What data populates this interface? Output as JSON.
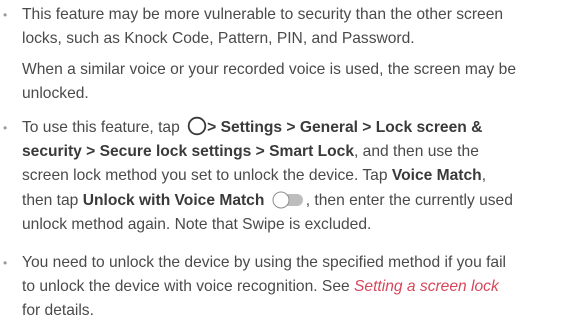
{
  "bullet_symbol": "•",
  "item1": {
    "line1": "This feature may be more vulnerable to security than the other screen",
    "line2": "locks, such as Knock Code, Pattern, PIN, and Password.",
    "line3": "When a similar voice or your recorded voice is used, the screen may be",
    "line4": "unlocked."
  },
  "item2": {
    "p1": "To use this feature, tap",
    "sep": ">",
    "settings": "Settings",
    "general": "General",
    "lock_screen": "Lock screen &",
    "security": "security",
    "secure_lock_settings": "Secure lock settings",
    "smart_lock": "Smart Lock",
    "p2": ", and then use the",
    "p3": "screen lock method you set to unlock the device. Tap",
    "voice_match": "Voice Match",
    "comma": ",",
    "p4": "then tap",
    "unlock_with_voice_match": "Unlock with Voice Match",
    "p5": ", then enter the currently used",
    "p6": "unlock method again. Note that Swipe is excluded."
  },
  "item3": {
    "line1": "You need to unlock the device by using the specified method if you fail",
    "line2_a": "to unlock the device with voice recognition. See",
    "link": "Setting a screen lock",
    "line3": "for details."
  },
  "icons": {
    "home": "home-button-icon",
    "toggle": "toggle-switch-icon"
  },
  "colors": {
    "text": "#4a4a4a",
    "bold": "#3a3a3a",
    "link": "#d8465a",
    "bullet": "#9a9a9a"
  }
}
